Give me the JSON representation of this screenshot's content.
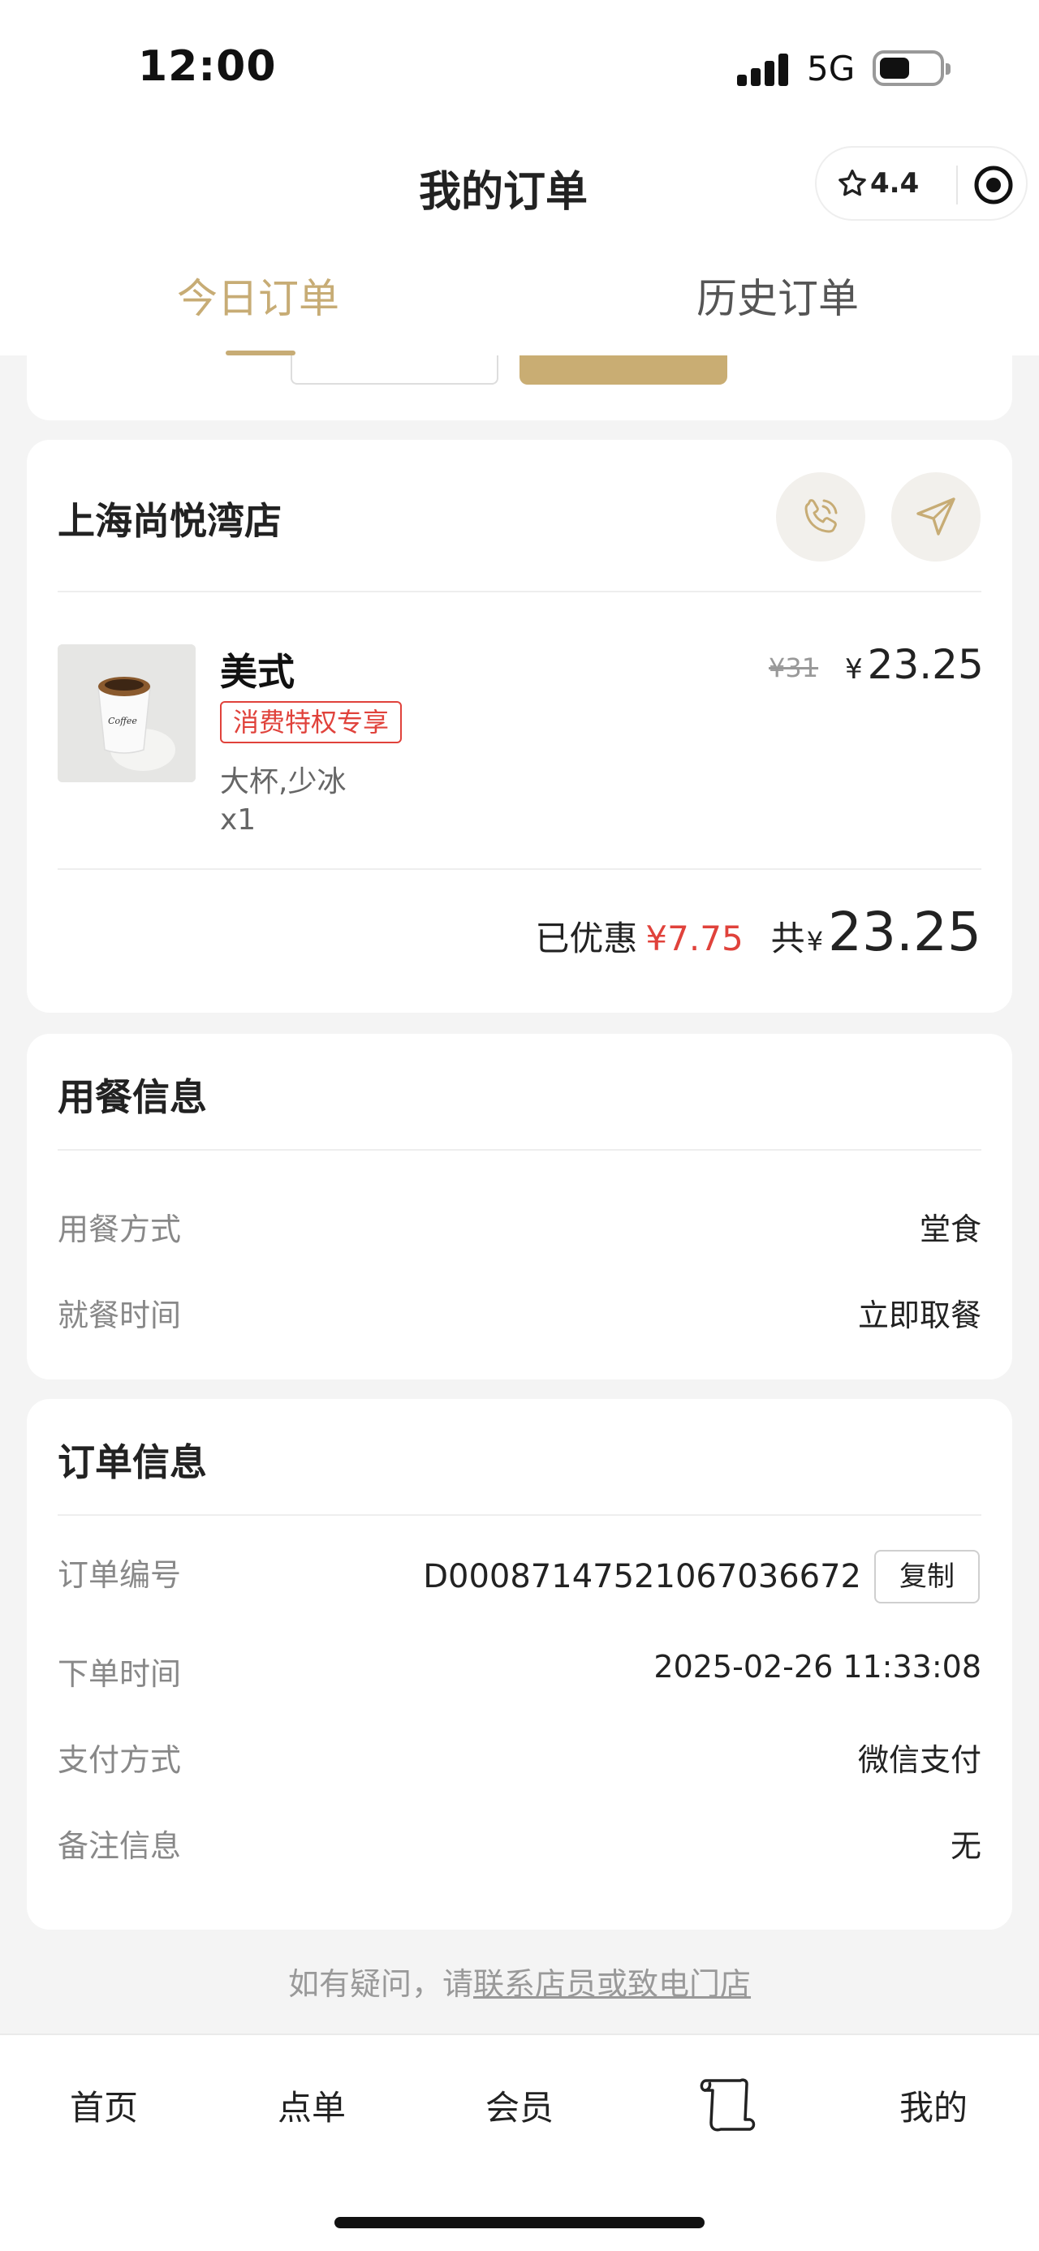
{
  "status_bar": {
    "time": "12:00",
    "network": "5G"
  },
  "header": {
    "title": "我的订单",
    "rating": "4.4",
    "tabs": [
      {
        "label": "今日订单",
        "active": true
      },
      {
        "label": "历史订单",
        "active": false
      }
    ]
  },
  "store": {
    "name": "上海尚悦湾店",
    "phone_icon": "phone-icon",
    "navigate_icon": "navigate-icon"
  },
  "product": {
    "name": "美式",
    "badge": "消费特权专享",
    "spec": "大杯,少冰",
    "qty": "x1",
    "original_price": "¥31",
    "currency": "¥",
    "price": "23.25"
  },
  "summary": {
    "discount_label": "已优惠",
    "discount": "¥7.75",
    "total_label": "共",
    "currency": "¥",
    "total": "23.25"
  },
  "dining": {
    "title": "用餐信息",
    "rows": [
      {
        "label": "用餐方式",
        "value": "堂食"
      },
      {
        "label": "就餐时间",
        "value": "立即取餐"
      }
    ]
  },
  "order": {
    "title": "订单信息",
    "copy_label": "复制",
    "rows": [
      {
        "label": "订单编号",
        "value": "D0008714752106703667​2"
      },
      {
        "label": "下单时间",
        "value": "2025-02-26 11:33:08"
      },
      {
        "label": "支付方式",
        "value": "微信支付"
      },
      {
        "label": "备注信息",
        "value": "无"
      }
    ]
  },
  "help": {
    "prefix": "如有疑问，请",
    "link": "联系店员或致电门店"
  },
  "bottom_nav": {
    "items": [
      {
        "label": "首页"
      },
      {
        "label": "点单"
      },
      {
        "label": "会员"
      },
      {
        "label": ""
      },
      {
        "label": "我的"
      }
    ]
  },
  "colors": {
    "accent": "#c7ac75",
    "discount_red": "#e0423b"
  }
}
